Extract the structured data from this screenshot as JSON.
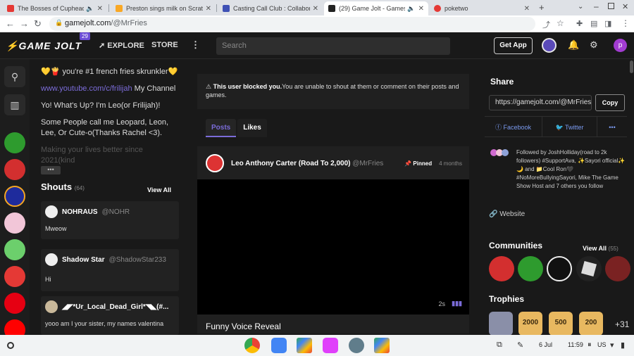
{
  "browser": {
    "tabs": [
      {
        "title": "The Bosses of Cuphead Ru",
        "favicon_color": "#e53935"
      },
      {
        "title": "Preston sings milk on Scratch",
        "favicon_color": "#f9a825"
      },
      {
        "title": "Casting Call Club : Collaborati",
        "favicon_color": "#3f51b5"
      },
      {
        "title": "(29) Game Jolt - Games fo",
        "favicon_color": "#222222"
      },
      {
        "title": "poketwo",
        "favicon_color": "#e53935"
      }
    ],
    "url_host": "gamejolt.com",
    "url_path": "/@MrFries"
  },
  "header": {
    "logo": "GAME JOLT",
    "logo_badge": "29",
    "explore": "EXPLORE",
    "store": "STORE",
    "search_placeholder": "Search",
    "get_app": "Get App",
    "avatar_letter": "p",
    "accent": "#7b6cd9"
  },
  "about": {
    "line1": "💛🍟 you're #1 french fries skrunkler💛",
    "youtube": "www.youtube.com/c/frilijah",
    "youtube_suffix": " My Channel",
    "line3": "Yo! What's Up? I'm Leo(or Frilijah)!",
    "line4": "Some People call me Leopard, Leon, Lee, Or Cute-o(Thanks Rachel <3).",
    "line5": "Making your lives better since 2021(kind",
    "more": "•••"
  },
  "shouts": {
    "title": "Shouts",
    "count": "(64)",
    "view_all": "View All",
    "items": [
      {
        "name": "NOHRAUS",
        "handle": "@NOHR",
        "text": "Mweow"
      },
      {
        "name": "Shadow Star",
        "handle": "@ShadowStar233",
        "text": "Hi"
      },
      {
        "name": "◢◤*Ur_Local_Dead_Girl*◥◣(#...",
        "handle": "",
        "text": "yooo am I your sister, my names valentina"
      }
    ]
  },
  "feed": {
    "blocked_bold": "This user blocked you.",
    "blocked_text": "You are unable to shout at them or comment on their posts and games.",
    "tab_posts": "Posts",
    "tab_likes": "Likes",
    "post": {
      "author": "Leo Anthony Carter (Road To 2,000)",
      "handle": "@MrFries",
      "pinned": "Pinned",
      "ago": "4 months",
      "video_time": "2s",
      "title": "Funny Voice Reveal"
    }
  },
  "sidebar": {
    "share_title": "Share",
    "share_url": "https://gamejolt.com/@MrFries",
    "copy": "Copy",
    "facebook": "Facebook",
    "twitter": "Twitter",
    "more": "•••",
    "followed_by": "Followed by JoshHolliday(road to 2k followers) #SupportAva, ✨Sayori official✨🌙 and 📁Cool Ron🖤 #NoMoreBullyingSayori, Mike The Game Show Host and 7 others you follow",
    "website": "Website",
    "communities_title": "Communities",
    "communities_view_all": "View All",
    "communities_count": "(55)",
    "trophies_title": "Trophies",
    "trophies": [
      "2000",
      "500",
      "200"
    ],
    "trophies_more": "+31"
  },
  "shelf": {
    "date": "6 Jul",
    "time": "11:59",
    "lang": "US"
  }
}
